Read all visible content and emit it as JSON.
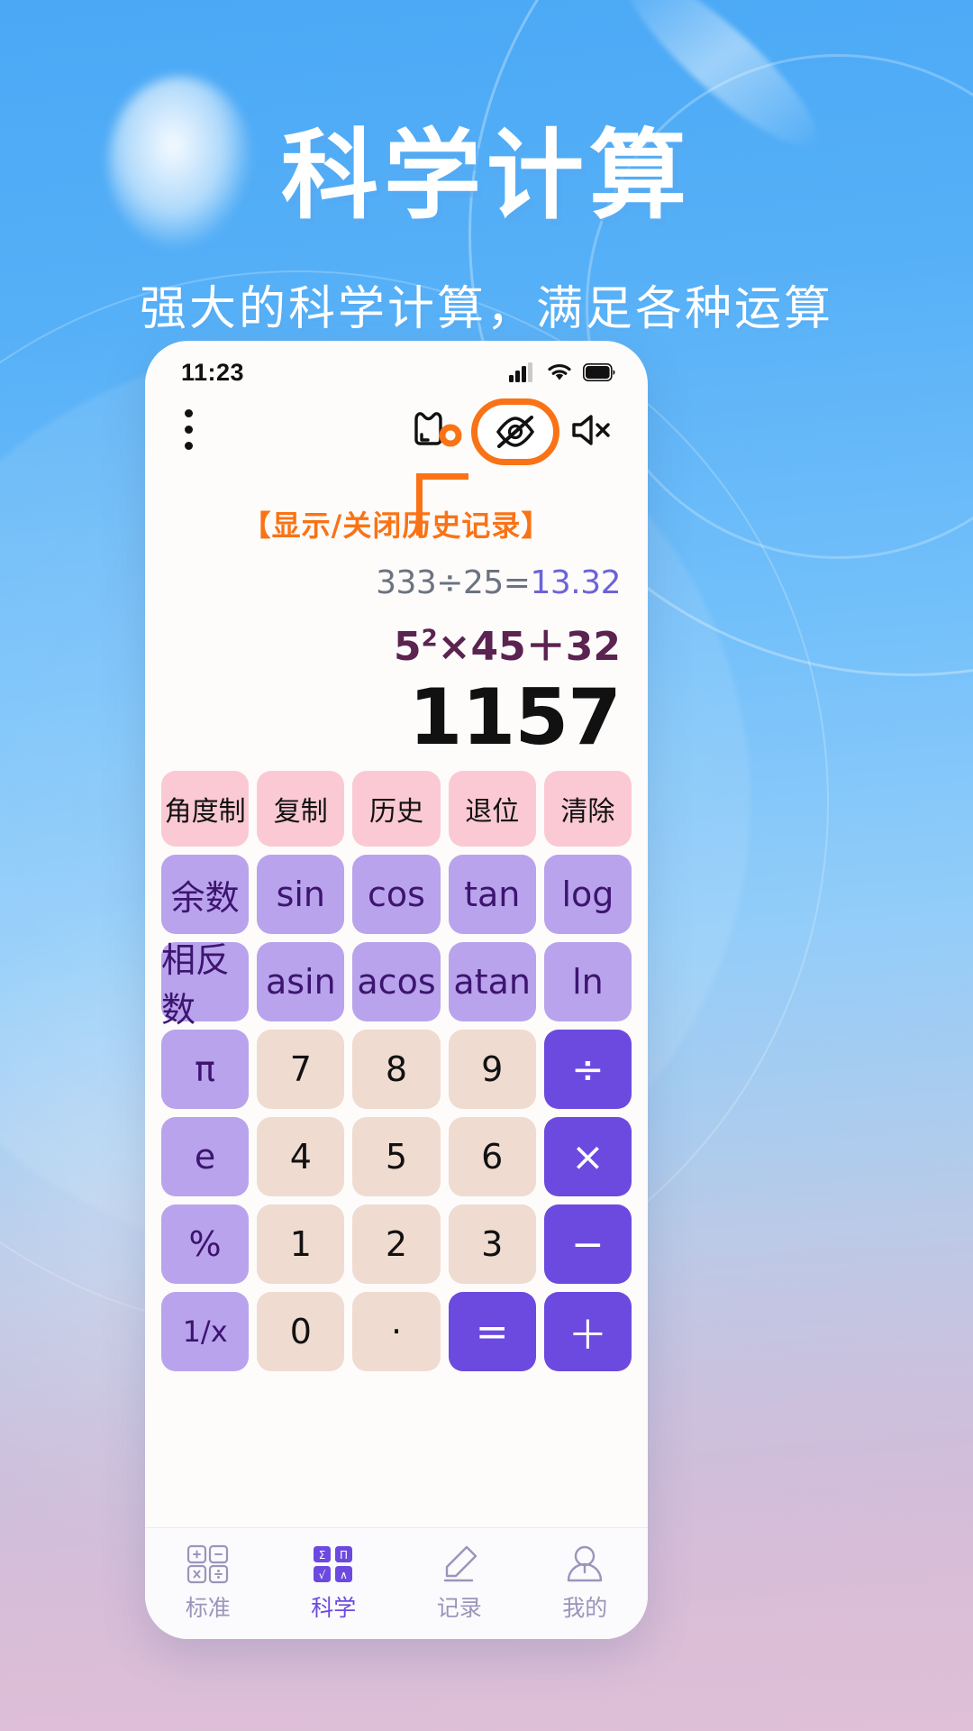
{
  "promo": {
    "title": "科学计算",
    "subtitle": "强大的科学计算，满足各种运算"
  },
  "colors": {
    "accent_orange": "#f97316",
    "brand_purple": "#6c4ae0",
    "bg_blue": "#56b0f7",
    "pink_key": "#fbc9d4",
    "purple_key": "#b9a3ec",
    "num_key": "#efdbd0"
  },
  "phone": {
    "status_bar": {
      "time": "11:23",
      "icons": [
        "signal-icon",
        "wifi-icon",
        "battery-icon"
      ]
    },
    "toolbar": {
      "menu_icon": "kebab-menu-icon",
      "cursor_icon": "tap-cursor-icon",
      "history_toggle_icon": "eye-off-icon",
      "sound_icon": "speaker-mute-icon",
      "annotation": "【显示/关闭历史记录】"
    },
    "display": {
      "history_expression": "333÷25=",
      "history_result": "13.32",
      "expression_base": "5",
      "expression_exponent": "2",
      "expression_rest": "×45＋32",
      "result": "1157"
    },
    "keypad": {
      "rows": [
        {
          "style": "k-pink",
          "keys": [
            "角度制",
            "复制",
            "历史",
            "退位",
            "清除"
          ]
        },
        {
          "style": "k-purple",
          "keys": [
            "余数",
            "sin",
            "cos",
            "tan",
            "log"
          ]
        },
        {
          "style": "k-purple",
          "keys": [
            "相反数",
            "asin",
            "acos",
            "atan",
            "ln"
          ]
        }
      ],
      "grid_rows": [
        {
          "keys": [
            {
              "label": "π",
              "style": "k-purple"
            },
            {
              "label": "7",
              "style": "k-num"
            },
            {
              "label": "8",
              "style": "k-num"
            },
            {
              "label": "9",
              "style": "k-num"
            },
            {
              "label": "÷",
              "style": "k-op"
            }
          ]
        },
        {
          "keys": [
            {
              "label": "e",
              "style": "k-purple"
            },
            {
              "label": "4",
              "style": "k-num"
            },
            {
              "label": "5",
              "style": "k-num"
            },
            {
              "label": "6",
              "style": "k-num"
            },
            {
              "label": "×",
              "style": "k-op"
            }
          ]
        },
        {
          "keys": [
            {
              "label": "%",
              "style": "k-purple"
            },
            {
              "label": "1",
              "style": "k-num"
            },
            {
              "label": "2",
              "style": "k-num"
            },
            {
              "label": "3",
              "style": "k-num"
            },
            {
              "label": "−",
              "style": "k-op"
            }
          ]
        },
        {
          "keys": [
            {
              "label": "1/x",
              "style": "k-purple"
            },
            {
              "label": "0",
              "style": "k-num"
            },
            {
              "label": "·",
              "style": "k-num"
            },
            {
              "label": "=",
              "style": "k-op"
            },
            {
              "label": "＋",
              "style": "k-op"
            }
          ]
        }
      ]
    },
    "navbar": {
      "items": [
        {
          "label": "标准",
          "icon": "calculator-grid-icon",
          "active": false
        },
        {
          "label": "科学",
          "icon": "sigma-grid-icon",
          "active": true
        },
        {
          "label": "记录",
          "icon": "pencil-icon",
          "active": false
        },
        {
          "label": "我的",
          "icon": "person-icon",
          "active": false
        }
      ]
    }
  }
}
